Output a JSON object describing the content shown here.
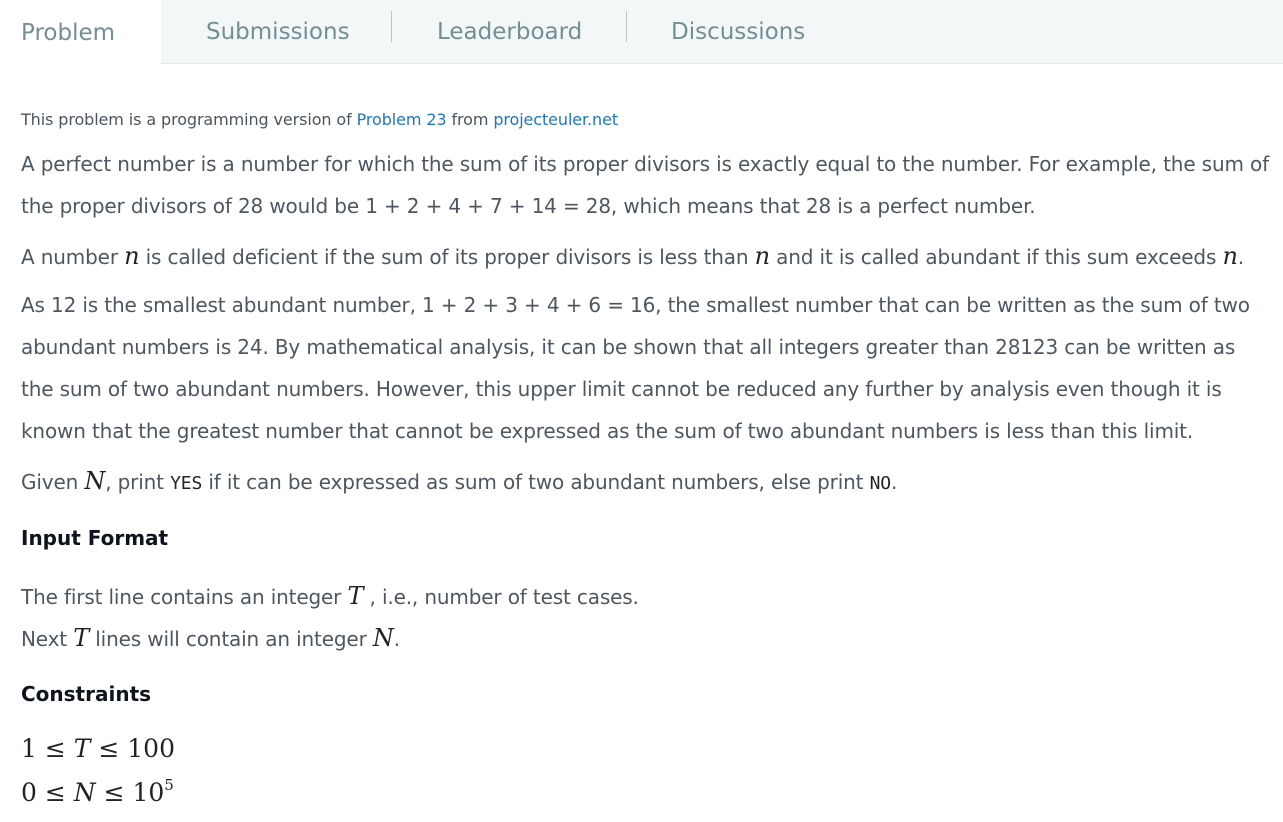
{
  "tabs": [
    {
      "label": "Problem",
      "active": true
    },
    {
      "label": "Submissions"
    },
    {
      "label": "Leaderboard"
    },
    {
      "label": "Discussions"
    }
  ],
  "note": {
    "prefix": "This problem is a programming version of ",
    "link1": "Problem 23",
    "middle": " from ",
    "link2": "projecteuler.net"
  },
  "paragraphs": {
    "p1": "A perfect number is a number for which the sum of its proper divisors is exactly equal to the number. For example, the sum of the proper divisors of 28 would be 1 + 2 + 4 + 7 + 14 = 28, which means that 28 is a perfect number.",
    "p2_a": "A number ",
    "p2_var1": "n",
    "p2_b": " is called deficient if the sum of its proper divisors is less than ",
    "p2_var2": "n",
    "p2_c": " and it is called abundant if this sum exceeds ",
    "p2_var3": "n",
    "p2_d": ".",
    "p3": "As 12 is the smallest abundant number, 1 + 2 + 3 + 4 + 6 = 16, the smallest number that can be written as the sum of two abundant numbers is 24. By mathematical analysis, it can be shown that all integers greater than 28123 can be written as the sum of two abundant numbers. However, this upper limit cannot be reduced any further by analysis even though it is known that the greatest number that cannot be expressed as the sum of two abundant numbers is less than this limit.",
    "p4_a": "Given ",
    "p4_var": "N",
    "p4_b": ", print ",
    "p4_yes": "YES",
    "p4_c": " if it can be expressed as sum of two abundant numbers, else print ",
    "p4_no": "NO",
    "p4_d": "."
  },
  "input_format": {
    "heading": "Input Format",
    "line1_a": "The first line contains an integer ",
    "line1_var": "T",
    "line1_b": " , i.e., number of test cases.",
    "line2_a": "Next ",
    "line2_var": "T",
    "line2_b": " lines will contain an integer ",
    "line2_var2": "N",
    "line2_c": "."
  },
  "constraints": {
    "heading": "Constraints",
    "c1_a": "1 ≤ ",
    "c1_var": "T",
    "c1_b": " ≤ 100",
    "c2_a": "0 ≤ ",
    "c2_var": "N",
    "c2_b": " ≤ 10",
    "c2_exp": "5"
  },
  "colors": {
    "tabbar_bg": "#f3f7f7",
    "link": "#1c77c3",
    "text": "#4c5761",
    "heading": "#0e141e"
  }
}
